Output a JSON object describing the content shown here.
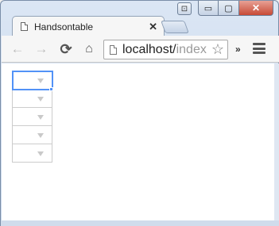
{
  "window": {
    "controls": {
      "minimize": "▭",
      "maximize": "▢",
      "close": "✕"
    }
  },
  "tab": {
    "title": "Handsontable",
    "close": "✕"
  },
  "toolbar": {
    "back": "←",
    "forward": "→",
    "reload": "⟳",
    "home": "⌂",
    "url_host": "localhost/",
    "url_path": "index",
    "star": "☆",
    "overflow": "»"
  },
  "grid": {
    "rows": 5,
    "cells": [
      "",
      "",
      "",
      "",
      ""
    ],
    "selected_row": 0,
    "cell_type": "dropdown"
  },
  "colors": {
    "selection": "#5292f7",
    "cell_border": "#cccccc",
    "dropdown_arrow": "#c9c9c9"
  }
}
